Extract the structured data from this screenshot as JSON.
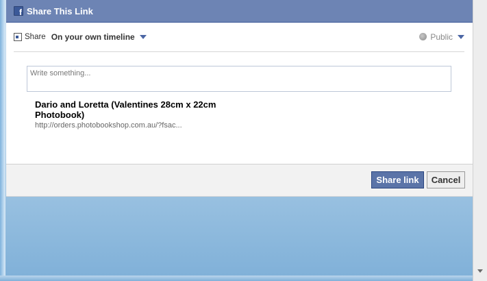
{
  "dialog": {
    "title": "Share This Link",
    "logo_letter": "f"
  },
  "share_bar": {
    "share_label": "Share",
    "destination": "On your own timeline",
    "privacy": "Public"
  },
  "composer": {
    "placeholder": "Write something..."
  },
  "link": {
    "title": "Dario and Loretta (Valentines 28cm x 22cm Photobook)",
    "url": "http://orders.photobookshop.com.au/?fsac..."
  },
  "buttons": {
    "share_label": "Share link",
    "cancel_label": "Cancel"
  },
  "colors": {
    "titlebar": "#6d84b4",
    "primary_button": "#5b74a8"
  }
}
